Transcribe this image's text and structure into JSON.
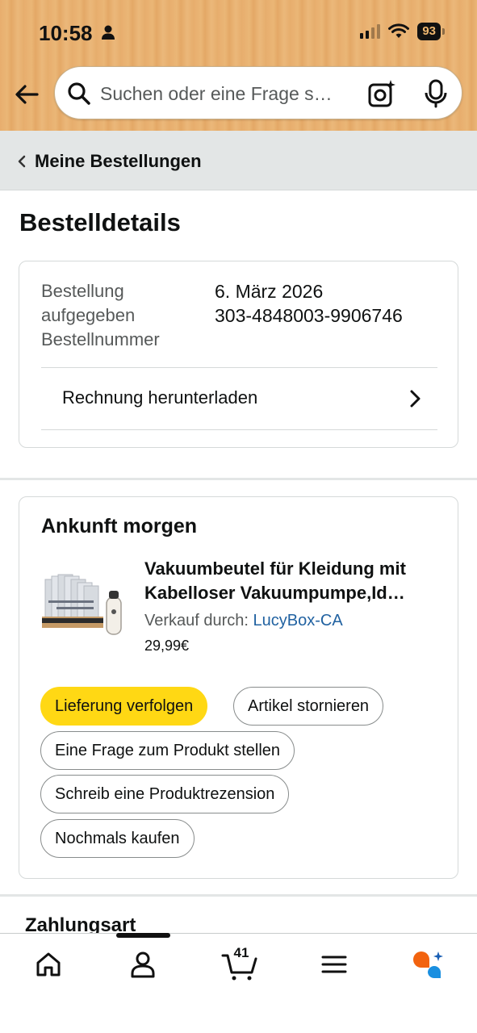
{
  "status_bar": {
    "time": "10:58",
    "battery": "93"
  },
  "search": {
    "placeholder": "Suchen oder eine Frage s…"
  },
  "breadcrumb": {
    "label": "Meine Bestellungen"
  },
  "page": {
    "title": "Bestelldetails"
  },
  "order": {
    "date_label": "Bestellung aufgegeben",
    "number_label": "Bestellnummer",
    "date_value": "6. März 2026",
    "number_value": "303-4848003-9906746",
    "invoice_label": "Rechnung herunterladen"
  },
  "shipment": {
    "status_title": "Ankunft morgen",
    "product_title_line1": "Vakuumbeutel für Kleidung mit",
    "product_title_line2": "Kabelloser Vakuumpumpe,Id…",
    "seller_prefix": "Verkauf durch:",
    "seller_name": "LucyBox-CA",
    "price": "29,99€",
    "buttons": {
      "track": "Lieferung verfolgen",
      "cancel": "Artikel stornieren",
      "question": "Eine Frage zum Produkt stellen",
      "review": "Schreib eine Produktrezension",
      "buy_again": "Nochmals kaufen"
    }
  },
  "payment": {
    "title": "Zahlungsart"
  },
  "bottom_nav": {
    "cart_count": "41",
    "items": [
      "home-icon",
      "account-icon",
      "cart-icon",
      "menu-icon",
      "rufus-ai-icon"
    ]
  },
  "colors": {
    "header_bg": "#e8ae6e",
    "primary_button": "#ffd814",
    "link": "#2162a1",
    "breadcrumb_bg": "#e3e6e6"
  }
}
